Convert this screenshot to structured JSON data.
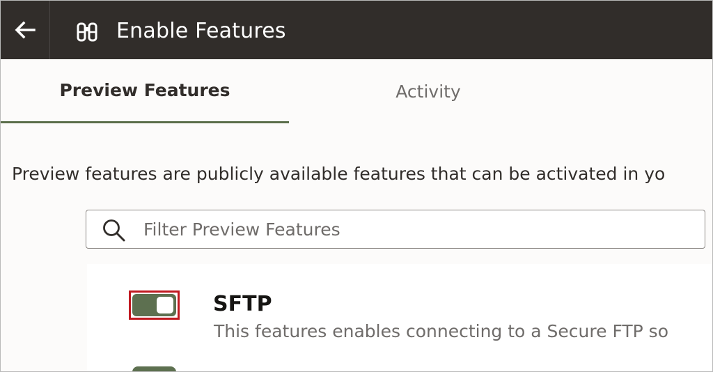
{
  "header": {
    "title": "Enable Features",
    "back_icon": "arrow-left-icon",
    "app_icon": "binoculars-icon"
  },
  "tabs": [
    {
      "label": "Preview Features",
      "active": true
    },
    {
      "label": "Activity",
      "active": false
    }
  ],
  "description": "Preview features are publicly available features that can be activated in yo",
  "search": {
    "placeholder": "Filter Preview Features",
    "value": ""
  },
  "features": [
    {
      "name": "SFTP",
      "description": "This features enables connecting to a Secure FTP so",
      "enabled": true
    },
    {
      "name": "",
      "description": "",
      "enabled": true
    }
  ],
  "colors": {
    "header_bg": "#312d2a",
    "tab_underline": "#5a6e4a",
    "toggle_on": "#5d7050",
    "highlight": "#c0181f"
  }
}
